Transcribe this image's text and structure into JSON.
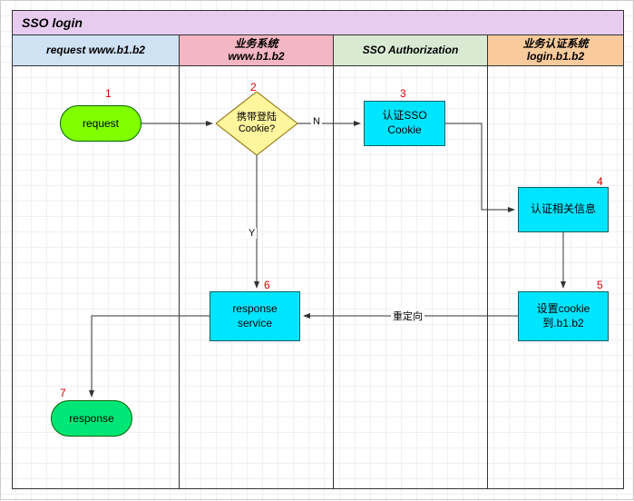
{
  "diagram": {
    "title": "SSO login",
    "lanes": [
      {
        "header": "request www.b1.b2"
      },
      {
        "header": "业务系统\nwww.b1.b2"
      },
      {
        "header": "SSO Authorization"
      },
      {
        "header": "业务认证系统\nlogin.b1.b2"
      }
    ],
    "nodes": {
      "n1": {
        "num": "1",
        "label": "request"
      },
      "n2": {
        "num": "2",
        "label": "携带登陆\nCookie?"
      },
      "n3": {
        "num": "3",
        "label": "认证SSO\nCookie"
      },
      "n4": {
        "num": "4",
        "label": "认证相关信息"
      },
      "n5": {
        "num": "5",
        "label": "设置cookie\n到.b1.b2"
      },
      "n6": {
        "num": "6",
        "label": "response\nservice"
      },
      "n7": {
        "num": "7",
        "label": "response"
      }
    },
    "edges": {
      "e_n": "N",
      "e_y": "Y",
      "e_redir": "重定向"
    }
  }
}
